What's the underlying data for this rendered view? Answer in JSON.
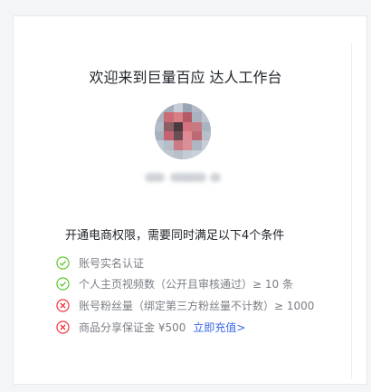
{
  "page": {
    "title": "欢迎来到巨量百应 达人工作台",
    "conditions_heading": "开通电商权限，需要同时满足以下4个条件"
  },
  "colors": {
    "ok": "#52c41a",
    "fail": "#f5222d",
    "link": "#3964e6"
  },
  "conditions": [
    {
      "text": "账号实名认证",
      "status": "ok",
      "icon": "check-circle-icon"
    },
    {
      "text": "个人主页视频数（公开且审核通过）≥ 10 条",
      "status": "ok",
      "icon": "check-circle-icon"
    },
    {
      "text": "账号粉丝量（绑定第三方粉丝量不计数）≥ 1000",
      "status": "fail",
      "icon": "cross-circle-icon"
    },
    {
      "text": "商品分享保证金 ¥500",
      "status": "fail",
      "icon": "cross-circle-icon",
      "link_label": "立即充值>"
    }
  ]
}
